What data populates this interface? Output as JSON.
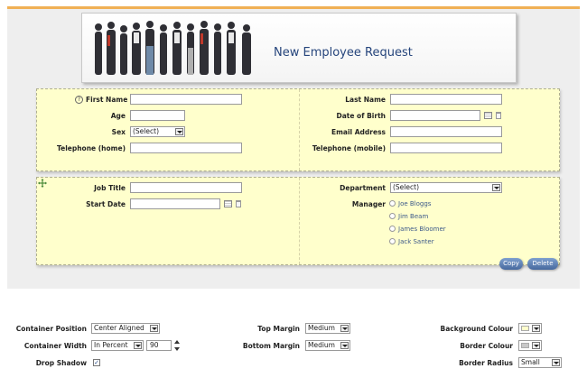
{
  "banner": {
    "title": "New Employee Request"
  },
  "form1": {
    "first_name": "First Name",
    "last_name": "Last Name",
    "age": "Age",
    "dob": "Date of Birth",
    "sex": "Sex",
    "sex_value": "(Select)",
    "email": "Email Address",
    "tel_home": "Telephone (home)",
    "tel_mobile": "Telephone (mobile)"
  },
  "form2": {
    "job_title": "Job Title",
    "department": "Department",
    "department_value": "(Select)",
    "start_date": "Start Date",
    "manager": "Manager",
    "managers": [
      "Joe Bloggs",
      "Jim Beam",
      "James Bloomer",
      "Jack Santer"
    ],
    "copy_label": "Copy",
    "delete_label": "Delete"
  },
  "props": {
    "container_position": "Container Position",
    "container_position_value": "Center Aligned",
    "container_width": "Container Width",
    "container_width_value": "In Percent",
    "width_number": "90",
    "drop_shadow": "Drop Shadow",
    "drop_shadow_checked": true,
    "top_margin": "Top Margin",
    "top_margin_value": "Medium",
    "bottom_margin": "Bottom Margin",
    "bottom_margin_value": "Medium",
    "background_colour": "Background Colour",
    "background_colour_value": "#ffffcc",
    "border_colour": "Border Colour",
    "border_colour_value": "#c8c8c8",
    "border_radius": "Border Radius",
    "border_radius_value": "Small"
  },
  "icons": {
    "help": "help-icon",
    "calendar": "calendar-icon",
    "delete": "trash-icon",
    "move": "move-icon"
  }
}
